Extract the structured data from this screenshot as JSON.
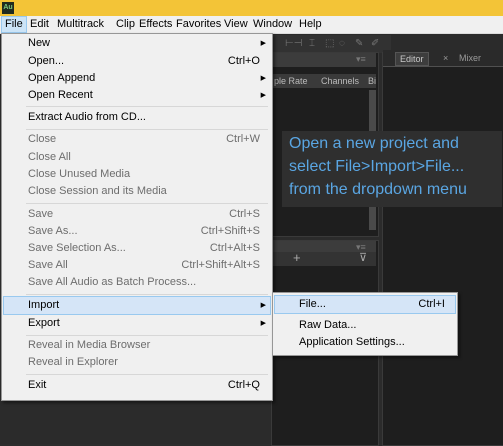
{
  "app": {
    "icon_text": "Au"
  },
  "menubar": [
    {
      "label": "File",
      "active": true
    },
    {
      "label": "Edit"
    },
    {
      "label": "Multitrack"
    },
    {
      "label": "Clip"
    },
    {
      "label": "Effects"
    },
    {
      "label": "Favorites"
    },
    {
      "label": "View"
    },
    {
      "label": "Window"
    },
    {
      "label": "Help"
    }
  ],
  "editor_tabs": {
    "editor": "Editor",
    "close": "×",
    "mixer": "Mixer"
  },
  "files_columns": {
    "sample_rate": "ple Rate",
    "channels": "Channels",
    "bits": "Bi"
  },
  "callout": {
    "line1": "Open a new project and",
    "line2": "select File>Import>File...",
    "line3": "from the dropdown menu",
    "color": "#5aa6e3"
  },
  "file_menu": {
    "new": {
      "label": "New"
    },
    "open": {
      "label": "Open...",
      "shortcut": "Ctrl+O"
    },
    "open_append": {
      "label": "Open Append"
    },
    "open_recent": {
      "label": "Open Recent"
    },
    "extract_audio": {
      "label": "Extract Audio from CD..."
    },
    "close": {
      "label": "Close",
      "shortcut": "Ctrl+W"
    },
    "close_all": {
      "label": "Close All"
    },
    "close_unused": {
      "label": "Close Unused Media"
    },
    "close_session": {
      "label": "Close Session and its Media"
    },
    "save": {
      "label": "Save",
      "shortcut": "Ctrl+S"
    },
    "save_as": {
      "label": "Save As...",
      "shortcut": "Ctrl+Shift+S"
    },
    "save_selection_as": {
      "label": "Save Selection As...",
      "shortcut": "Ctrl+Alt+S"
    },
    "save_all": {
      "label": "Save All",
      "shortcut": "Ctrl+Shift+Alt+S"
    },
    "save_all_batch": {
      "label": "Save All Audio as Batch Process..."
    },
    "import": {
      "label": "Import"
    },
    "export": {
      "label": "Export"
    },
    "reveal_media_browser": {
      "label": "Reveal in Media Browser"
    },
    "reveal_explorer": {
      "label": "Reveal in Explorer"
    },
    "exit": {
      "label": "Exit",
      "shortcut": "Ctrl+Q"
    }
  },
  "import_submenu": {
    "file": {
      "label": "File...",
      "shortcut": "Ctrl+I"
    },
    "raw_data": {
      "label": "Raw Data..."
    },
    "app_settings": {
      "label": "Application Settings..."
    }
  },
  "glyphs": {
    "submenu_arrow": "▶",
    "plus": "+",
    "filter": "⊽"
  }
}
